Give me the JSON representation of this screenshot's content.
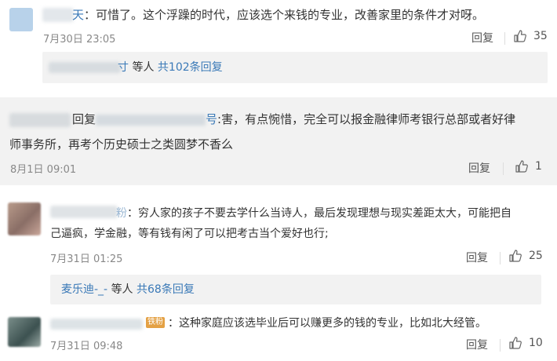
{
  "comment1": {
    "name_suffix": "天",
    "text": "可惜了。这个浮躁的时代，应该选个来钱的专业，改善家里的条件才对呀。",
    "time": "7月30日 23:05",
    "reply_label": "回复",
    "likes": "35",
    "sub": {
      "name_suffix": "寸",
      "and_others": "等人",
      "count_link": "共102条回复"
    }
  },
  "comment2": {
    "reply_prefix": "回复",
    "mention_suffix": "号",
    "text_line1": ":害，有点惋惜，完全可以报金融律师考银行总部或者好律",
    "text_line2": "师事务所，再考个历史硕士之类圆梦不香么",
    "time": "8月1日 09:01",
    "reply_label": "回复",
    "likes": "1"
  },
  "comment3": {
    "name_suffix": "粉",
    "text_line1": "穷人家的孩子不要去学什么当诗人，最后发现理想与现实差距太大，可能把自",
    "text_line2": "己逼疯，学金融，等有钱有闲了可以把考古当个爱好也行;",
    "time": "7月31日 01:25",
    "reply_label": "回复",
    "likes": "25",
    "sub": {
      "name": "麦乐迪-_-",
      "and_others": "等人",
      "count_link": "共68条回复"
    }
  },
  "comment4": {
    "badge": "铁粉",
    "text": "这种家庭应该选毕业后可以赚更多的钱的专业，比如北大经管。",
    "time": "7月31日 09:48",
    "reply_label": "回复",
    "likes": "10"
  }
}
